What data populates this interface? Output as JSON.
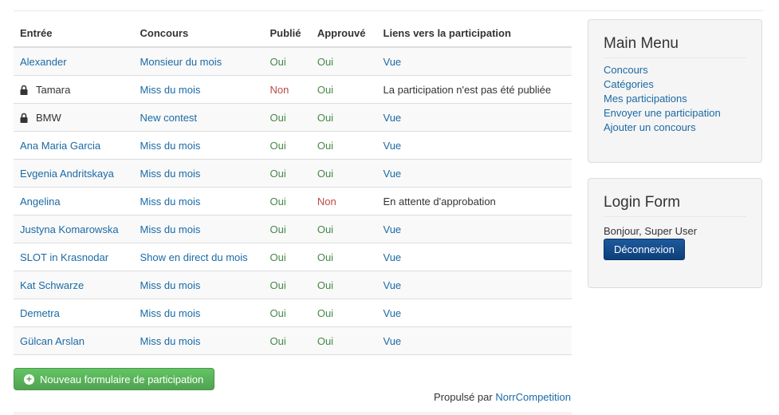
{
  "table": {
    "headers": [
      "Entrée",
      "Concours",
      "Publié",
      "Approuvé",
      "Liens vers la participation"
    ],
    "rows": [
      {
        "entry": "Alexander",
        "locked": false,
        "contest": "Monsieur du mois",
        "published": "Oui",
        "approved": "Oui",
        "link": "Vue",
        "link_is_link": true
      },
      {
        "entry": "Tamara",
        "locked": true,
        "contest": "Miss du mois",
        "published": "Non",
        "approved": "Oui",
        "link": "La participation n'est pas été publiée",
        "link_is_link": false
      },
      {
        "entry": "BMW",
        "locked": true,
        "contest": "New contest",
        "published": "Oui",
        "approved": "Oui",
        "link": "Vue",
        "link_is_link": true
      },
      {
        "entry": "Ana Maria Garcia",
        "locked": false,
        "contest": "Miss du mois",
        "published": "Oui",
        "approved": "Oui",
        "link": "Vue",
        "link_is_link": true
      },
      {
        "entry": "Evgenia Andritskaya",
        "locked": false,
        "contest": "Miss du mois",
        "published": "Oui",
        "approved": "Oui",
        "link": "Vue",
        "link_is_link": true
      },
      {
        "entry": "Angelina",
        "locked": false,
        "contest": "Miss du mois",
        "published": "Oui",
        "approved": "Non",
        "link": "En attente d'approbation",
        "link_is_link": false
      },
      {
        "entry": "Justyna Komarowska",
        "locked": false,
        "contest": "Miss du mois",
        "published": "Oui",
        "approved": "Oui",
        "link": "Vue",
        "link_is_link": true
      },
      {
        "entry": "SLOT in Krasnodar",
        "locked": false,
        "contest": "Show en direct du mois",
        "published": "Oui",
        "approved": "Oui",
        "link": "Vue",
        "link_is_link": true
      },
      {
        "entry": "Kat Schwarze",
        "locked": false,
        "contest": "Miss du mois",
        "published": "Oui",
        "approved": "Oui",
        "link": "Vue",
        "link_is_link": true
      },
      {
        "entry": "Demetra",
        "locked": false,
        "contest": "Miss du mois",
        "published": "Oui",
        "approved": "Oui",
        "link": "Vue",
        "link_is_link": true
      },
      {
        "entry": "Gülcan Arslan",
        "locked": false,
        "contest": "Miss du mois",
        "published": "Oui",
        "approved": "Oui",
        "link": "Vue",
        "link_is_link": true
      }
    ]
  },
  "new_entry_button": "Nouveau formulaire de participation",
  "powered_by": {
    "label": "Propulsé par",
    "link": "NorrCompetition"
  },
  "main_menu": {
    "title": "Main Menu",
    "items": [
      "Concours",
      "Catégories",
      "Mes participations",
      "Envoyer une participation",
      "Ajouter un concours"
    ]
  },
  "login_form": {
    "title": "Login Form",
    "greeting": "Bonjour, Super User",
    "logout": "Déconnexion"
  }
}
